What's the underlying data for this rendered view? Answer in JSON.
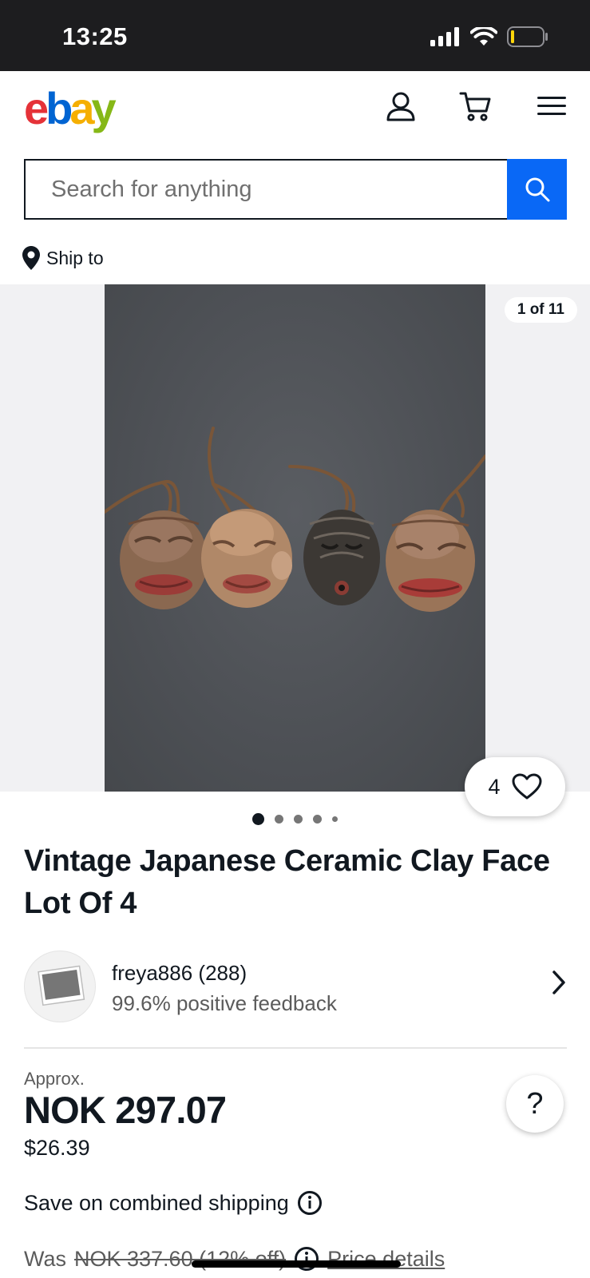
{
  "status_bar": {
    "time": "13:25"
  },
  "header": {
    "logo": {
      "e": "e",
      "b": "b",
      "a": "a",
      "y": "y"
    },
    "icons": [
      "account-icon",
      "cart-icon",
      "menu-icon"
    ]
  },
  "search": {
    "placeholder": "Search for anything",
    "value": ""
  },
  "ship_to": {
    "label": "Ship to"
  },
  "gallery": {
    "counter": "1 of 11",
    "watch_count": "4",
    "dots_total": 5,
    "active_dot": 1
  },
  "listing": {
    "title": "Vintage Japanese Ceramic Clay Face Lot Of 4"
  },
  "seller": {
    "name": "freya886 (288)",
    "feedback": "99.6% positive feedback"
  },
  "price": {
    "approx_label": "Approx.",
    "local": "NOK 297.07",
    "usd": "$26.39",
    "help_label": "?"
  },
  "shipping": {
    "combined_label": "Save on combined shipping"
  },
  "was_price": {
    "was_label": "Was",
    "old_price": "NOK 337.60 (12% off)",
    "details_link": "Price details"
  },
  "colors": {
    "logo_e": "#e53238",
    "logo_b": "#0064d2",
    "logo_a": "#f5af02",
    "logo_y": "#86b817",
    "search_button": "#0968f6"
  }
}
